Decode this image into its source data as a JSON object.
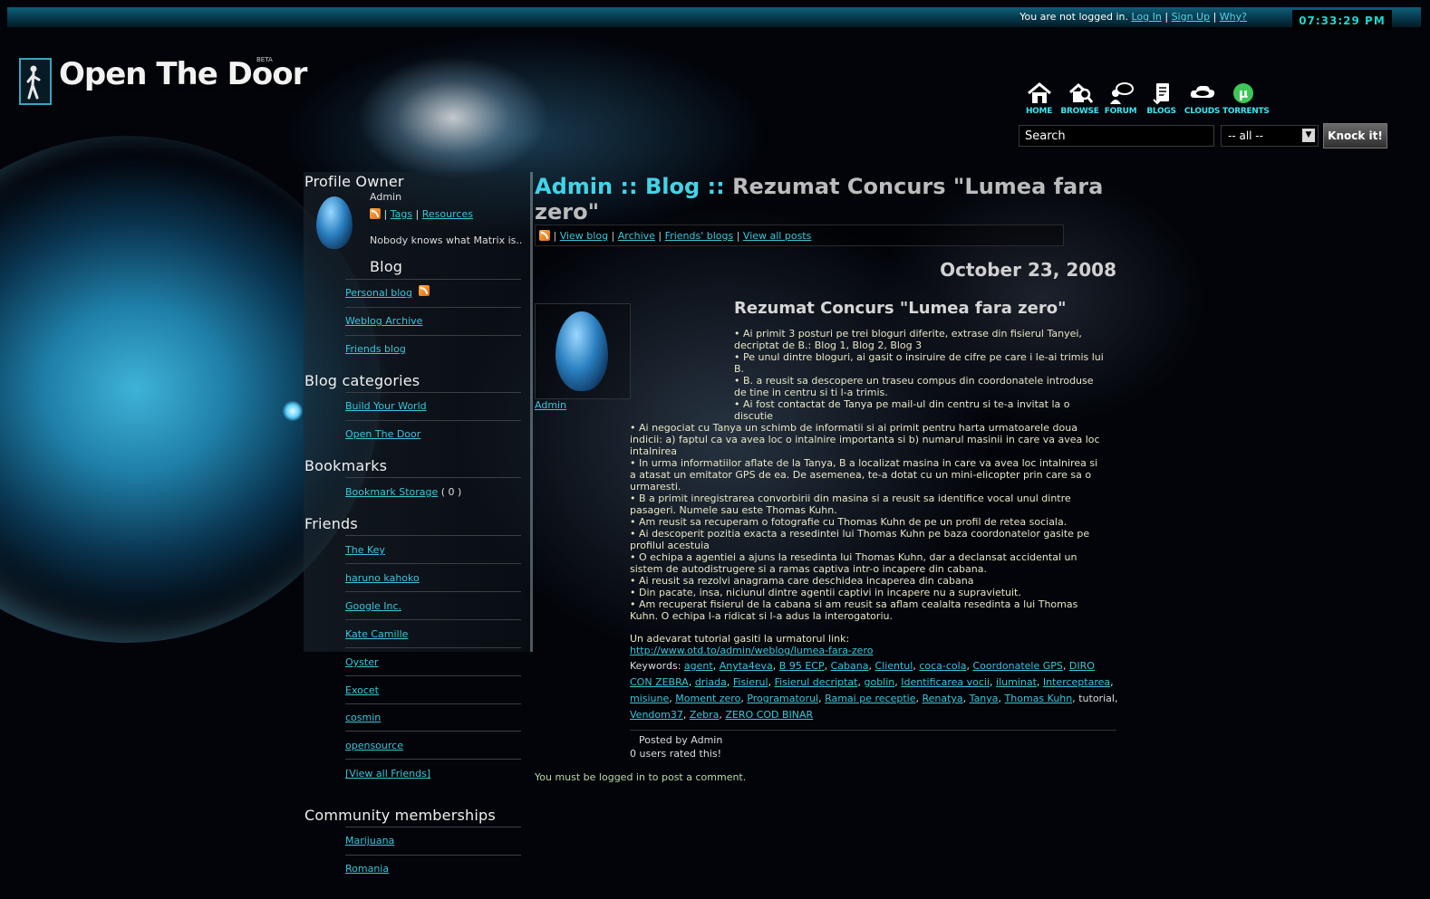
{
  "header": {
    "login_status": "You are not logged in.",
    "login_link": "Log In",
    "signup_link": "Sign Up",
    "why_link": "Why?",
    "clock": "07:33:29 PM"
  },
  "logo": {
    "text": "Open The Door",
    "badge": "BETA"
  },
  "nav": [
    {
      "label": "HOME",
      "icon": "home-icon"
    },
    {
      "label": "BROWSE",
      "icon": "browse-icon"
    },
    {
      "label": "FORUM",
      "icon": "forum-icon"
    },
    {
      "label": "BLOGS",
      "icon": "blogs-icon"
    },
    {
      "label": "CLOUDS",
      "icon": "clouds-icon"
    },
    {
      "label": "TORRENTS",
      "icon": "torrents-icon"
    }
  ],
  "search": {
    "value": "Search",
    "scope": "-- all --",
    "button": "Knock it!"
  },
  "sidebar": {
    "profile_heading": "Profile Owner",
    "owner_name": "Admin",
    "tags_link": "Tags",
    "resources_link": "Resources",
    "tagline": "Nobody knows what Matrix is..",
    "blog_heading": "Blog",
    "blog_links": [
      "Personal blog",
      "Weblog Archive",
      "Friends blog"
    ],
    "categories_heading": "Blog categories",
    "categories": [
      "Build Your World",
      "Open The Door"
    ],
    "bookmarks_heading": "Bookmarks",
    "bookmark_link": "Bookmark Storage",
    "bookmark_count": "( 0 )",
    "friends_heading": "Friends",
    "friends": [
      "The Key",
      "haruno kahoko",
      "Google Inc.",
      "Kate Camille",
      "Oyster",
      "Exocet",
      "cosmin",
      "opensource",
      "[View all Friends]"
    ],
    "communities_heading": "Community memberships",
    "communities": [
      "Marijuana",
      "Romania"
    ]
  },
  "main": {
    "title_part1": "Admin :: Blog :: ",
    "title_part2": "Rezumat Concurs \"Lumea fara zero\"",
    "subnav": [
      "View blog",
      "Archive",
      "Friends' blogs",
      "View all posts"
    ],
    "date": "October 23, 2008",
    "author": "Admin",
    "post_title": "Rezumat Concurs \"Lumea fara zero\"",
    "lines_narrow": [
      "• Ai primit 3 posturi pe trei bloguri diferite, extrase din fisierul Tanyei,",
      "decriptat de B.: Blog 1, Blog 2, Blog 3",
      "• Pe unul dintre bloguri, ai gasit o insiruire de cifre pe care i le-ai trimis lui",
      "B.",
      "• B. a reusit sa descopere un traseu compus din coordonatele introduse",
      "de tine in centru si ti l-a trimis.",
      "• Ai fost contactat de Tanya pe mail-ul din centru si te-a invitat la o",
      "discutie"
    ],
    "lines_wide": [
      "• Ai negociat cu Tanya un schimb de informatii si ai primit pentru harta urmatoarele doua",
      "indicii: a) faptul ca va avea loc o intalnire importanta si b) numarul masinii in care va avea loc",
      "intalnirea",
      "• In urma informatiilor aflate de la Tanya, B a localizat masina in care va avea loc intalnirea si",
      "a atasat un emitator GPS de ea. De asemenea, te-a dotat cu un mini-elicopter prin care sa o",
      "urmaresti.",
      "• B a primit inregistrarea convorbirii din masina si a reusit sa identifice vocal unul dintre",
      "pasageri. Numele sau este Thomas Kuhn.",
      "• Am reusit sa recuperam o fotografie cu Thomas Kuhn de pe un profil de retea sociala.",
      "• Ai descoperit pozitia exacta a resedintei lui Thomas Kuhn pe baza coordonatelor gasite pe",
      "profilul acestuia",
      "• O echipa a agentiei a ajuns la resedinta lui Thomas Kuhn, dar a declansat accidental un",
      "sistem de autodistrugere si a ramas captiva intr-o incapere din cabana.",
      "• Ai reusit sa rezolvi anagrama care deschidea incaperea din cabana",
      "• Din pacate, insa, niciunul dintre agentii captivi in incapere nu a supravietuit.",
      "• Am recuperat fisierul de la cabana si am reusit sa aflam cealalta resedinta a lui Thomas",
      "Kuhn. O echipa l-a ridicat si l-a adus la interogatoriu."
    ],
    "tutorial_text": "Un adevarat tutorial gasiti la urmatorul link:",
    "tutorial_link": "http://www.otd.to/admin/weblog/lumea-fara-zero",
    "keywords_label": "Keywords:",
    "keywords": [
      "agent",
      "Anyta4eva",
      "B 95 ECP",
      "Cabana",
      "Clientul",
      "coca-cola",
      "Coordonatele GPS",
      "DIRO CON ZEBRA",
      "driada",
      "Fisierul",
      "Fisierul decriptat",
      "goblin",
      "Identificarea vocii",
      "iluminat",
      "Interceptarea",
      "misiune",
      "Moment zero",
      "Programatorul",
      "Ramai pe receptie",
      "Renatya",
      "Tanya",
      "Thomas Kuhn",
      "tutorial",
      "Vendom37",
      "Zebra",
      "ZERO COD BINAR"
    ],
    "posted_by": "Posted by Admin",
    "rated": "0 users rated this!",
    "comment_note": "You must be logged in to post a comment."
  }
}
